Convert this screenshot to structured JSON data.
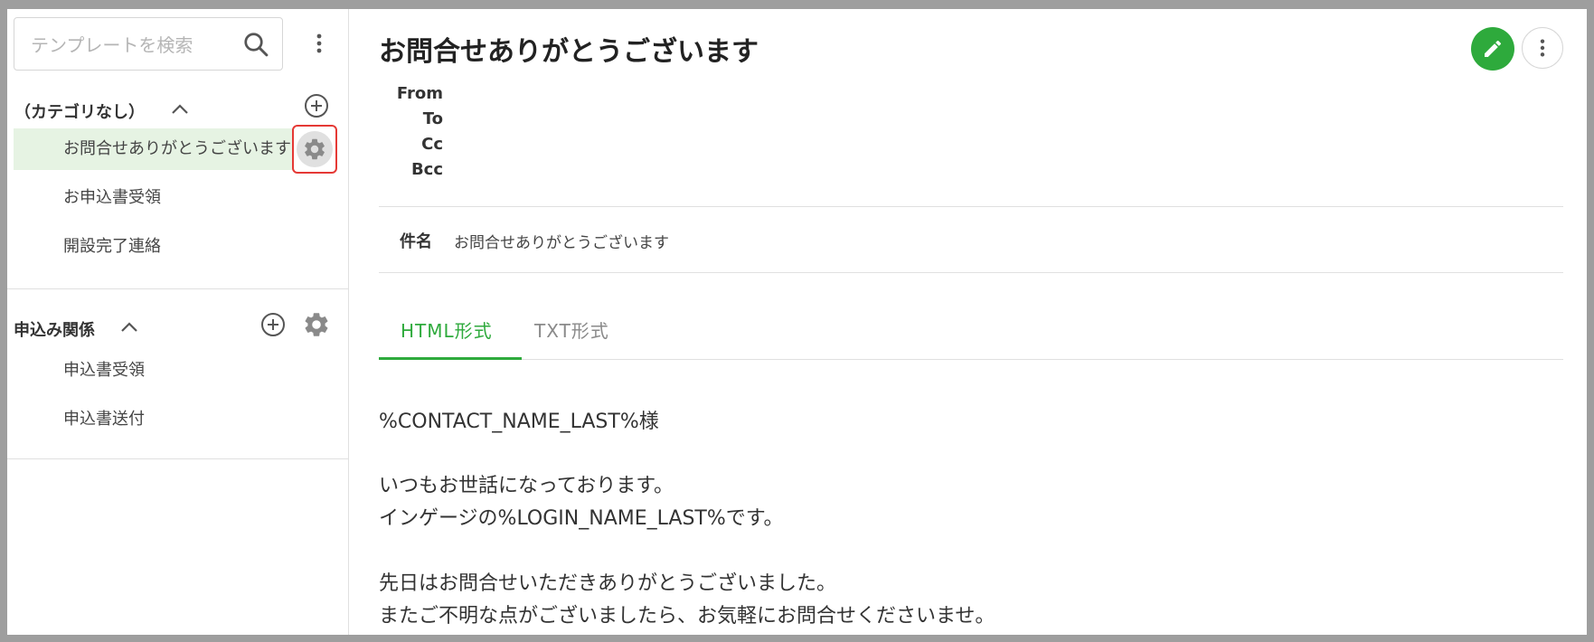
{
  "sidebar": {
    "search": {
      "placeholder": "テンプレートを検索",
      "value": ""
    },
    "categories": [
      {
        "title": "（カテゴリなし）",
        "items": [
          {
            "label": "お問合せありがとうございます",
            "active": true
          },
          {
            "label": "お申込書受領",
            "active": false
          },
          {
            "label": "開設完了連絡",
            "active": false
          }
        ]
      },
      {
        "title": "申込み関係",
        "items": [
          {
            "label": "申込書受領",
            "active": false
          },
          {
            "label": "申込書送付",
            "active": false
          }
        ]
      }
    ]
  },
  "main": {
    "title": "お問合せありがとうございます",
    "address_labels": {
      "from": "From",
      "to": "To",
      "cc": "Cc",
      "bcc": "Bcc"
    },
    "subject": {
      "label": "件名",
      "value": "お問合せありがとうございます"
    },
    "tabs": [
      {
        "label": "HTML形式",
        "active": true
      },
      {
        "label": "TXT形式",
        "active": false
      }
    ],
    "body_lines": [
      "%CONTACT_NAME_LAST%様",
      "",
      "いつもお世話になっております。",
      "インゲージの%LOGIN_NAME_LAST%です。",
      "",
      "先日はお問合せいただきありがとうございました。",
      "またご不明な点がございましたら、お気軽にお問合せくださいませ。"
    ]
  },
  "colors": {
    "accent": "#2eaa3c",
    "active_item_bg": "#e6f3e3",
    "highlight_border": "#e53935"
  },
  "icons": [
    "search-icon",
    "kebab-menu-icon",
    "chevron-up-icon",
    "plus-circle-icon",
    "gear-icon",
    "pencil-icon"
  ]
}
